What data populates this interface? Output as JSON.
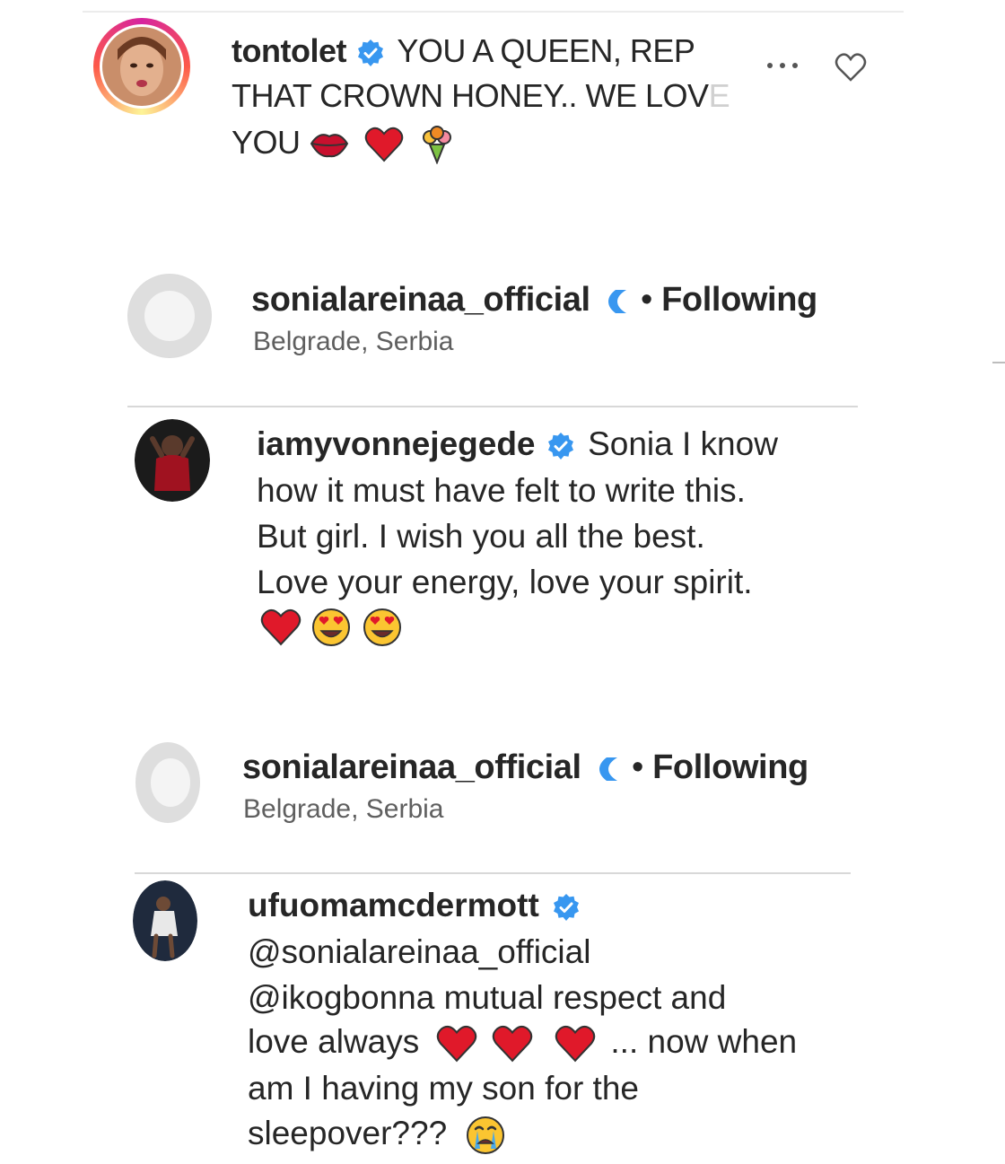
{
  "comments": [
    {
      "username": "tontolet",
      "text_1": "YOU A QUEEN, REP",
      "text_2": "THAT CROWN HONEY.. WE LOV",
      "text_2_faded": "E",
      "text_3": "YOU",
      "emojis": [
        "kiss-lips",
        "red-heart",
        "bouquet"
      ]
    },
    {
      "username": "iamyvonnejegede",
      "lines": [
        "Sonia I know",
        "how it must have felt to write this.",
        "But girl. I wish you all the best.",
        "Love your energy, love your spirit."
      ],
      "emojis": [
        "red-heart",
        "heart-eyes",
        "heart-eyes"
      ]
    },
    {
      "username": "ufuomamcdermott",
      "line_1": "@sonialareinaa_official",
      "line_2": "@ikogbonna mutual respect and",
      "line_3_a": "love always",
      "line_3_b": "... now when",
      "line_4": "am I having my son for the",
      "line_5": "sleepover???",
      "emojis": [
        "red-heart",
        "red-heart",
        "red-heart",
        "crying-face"
      ]
    }
  ],
  "profile_headers": [
    {
      "username": "sonialareinaa_official",
      "separator": "•",
      "status": "Following",
      "location": "Belgrade, Serbia"
    },
    {
      "username": "sonialareinaa_official",
      "separator": "•",
      "status": "Following",
      "location": "Belgrade, Serbia"
    }
  ],
  "colors": {
    "verified": "#3897f0",
    "heart": "#e0192a",
    "text": "#262626"
  }
}
